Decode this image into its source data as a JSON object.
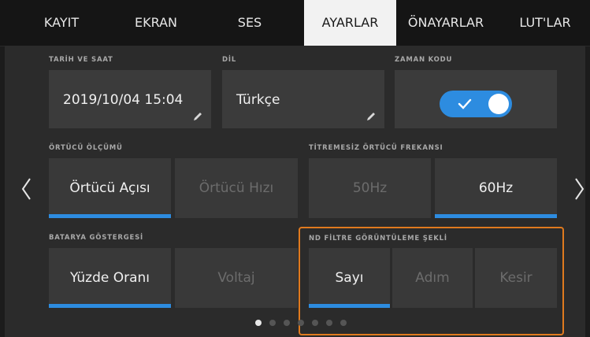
{
  "tabs": [
    "KAYIT",
    "EKRAN",
    "SES",
    "AYARLAR",
    "ÖNAYARLAR",
    "LUT'LAR"
  ],
  "active_tab": "AYARLAR",
  "date_time": {
    "label": "TARİH VE SAAT",
    "value": "2019/10/04  15:04"
  },
  "language": {
    "label": "DİL",
    "value": "Türkçe"
  },
  "timecode": {
    "label": "ZAMAN KODU",
    "enabled": true
  },
  "shutter_measurement": {
    "label": "ÖRTÜCÜ ÖLÇÜMÜ",
    "options": [
      "Örtücü Açısı",
      "Örtücü Hızı"
    ],
    "selected": "Örtücü Açısı"
  },
  "flicker_free": {
    "label": "TİTREMESİZ ÖRTÜCÜ FREKANSI",
    "options": [
      "50Hz",
      "60Hz"
    ],
    "selected": "60Hz"
  },
  "battery": {
    "label": "BATARYA GÖSTERGESİ",
    "options": [
      "Yüzde Oranı",
      "Voltaj"
    ],
    "selected": "Yüzde Oranı"
  },
  "nd_filter": {
    "label": "ND FİLTRE GÖRÜNTÜLEME ŞEKLİ",
    "options": [
      "Sayı",
      "Adım",
      "Kesir"
    ],
    "selected": "Sayı"
  },
  "pagination": {
    "pages": 7,
    "current": 1
  },
  "colors": {
    "accent": "#2d8ce0",
    "highlight": "#e07a1e"
  }
}
